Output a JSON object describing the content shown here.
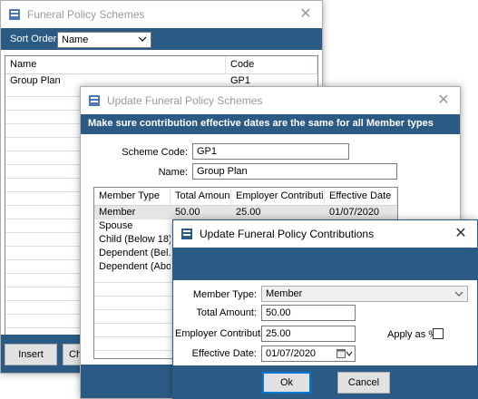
{
  "w1": {
    "title": "Funeral Policy Schemes",
    "sort_label": "Sort Order",
    "sort_value": "Name",
    "grid": {
      "headers": [
        "Name",
        "Code"
      ],
      "rows": [
        {
          "name": "Group Plan",
          "code": "GP1"
        }
      ]
    },
    "buttons": {
      "insert": "Insert",
      "change": "Ch"
    }
  },
  "w2": {
    "title": "Update Funeral Policy Schemes",
    "banner": "Make sure contribution  effective dates are the same for all Member types",
    "scheme_code_label": "Scheme Code:",
    "scheme_code": "GP1",
    "name_label": "Name:",
    "name": "Group Plan",
    "grid": {
      "headers": [
        "Member Type",
        "Total Amount",
        "Employer Contribution",
        "Effective Date"
      ],
      "rows": [
        {
          "type": "Member",
          "total": "50.00",
          "employer": "25.00",
          "date": "01/07/2020"
        },
        {
          "type": "Spouse",
          "total": "",
          "employer": "",
          "date": ""
        },
        {
          "type": "Child (Below 18)",
          "total": "",
          "employer": "",
          "date": ""
        },
        {
          "type": "Dependent (Bel...",
          "total": "",
          "employer": "",
          "date": ""
        },
        {
          "type": "Dependent (Abo...",
          "total": "",
          "employer": "",
          "date": ""
        }
      ]
    }
  },
  "w3": {
    "title": "Update Funeral Policy Contributions",
    "member_type_label": "Member Type:",
    "member_type": "Member",
    "total_label": "Total Amount:",
    "total": "50.00",
    "employer_label": "Employer Contribution:",
    "employer": "25.00",
    "apply_label": "Apply as %",
    "apply_checked": false,
    "date_label": "Effective Date:",
    "date": "01/07/2020",
    "ok": "Ok",
    "cancel": "Cancel"
  },
  "colors": {
    "accent": "#2b5b84",
    "focus": "#0078d7"
  }
}
